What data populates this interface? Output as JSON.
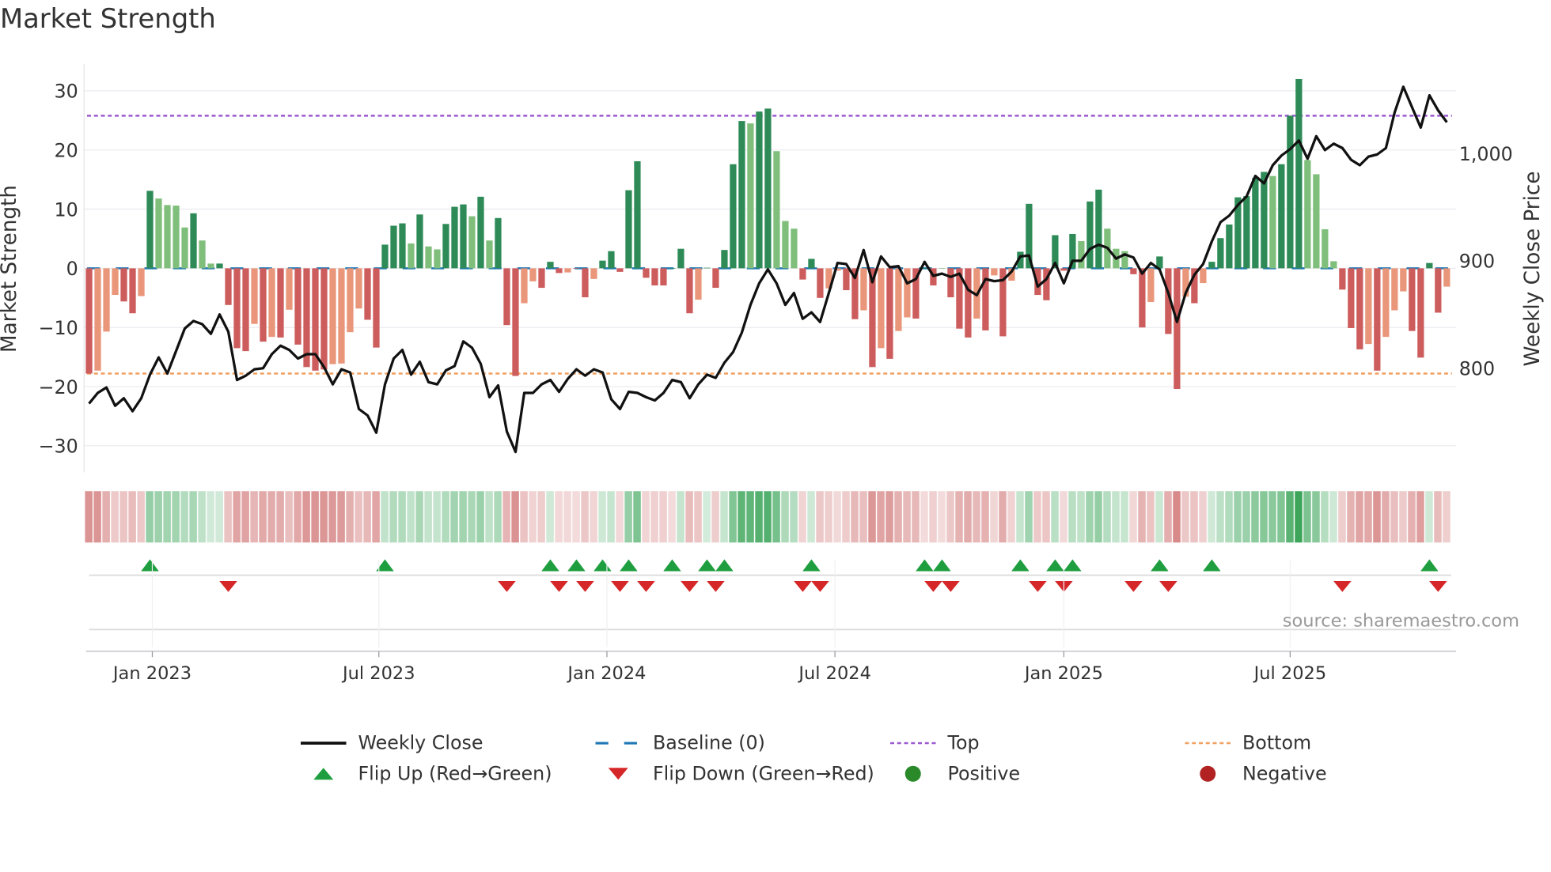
{
  "title": "Market Strength",
  "source": "source: sharemaestro.com",
  "colors": {
    "strong_up": "#2e8b57",
    "weak_up": "#7fbf7b",
    "strong_down": "#cd5c5c",
    "weak_down": "#e9967a",
    "close": "#111111",
    "baseline": "#1f77b4",
    "top": "#9b59d0",
    "bottom": "#f0a060",
    "flip_up": "#1e9e3e",
    "flip_down": "#d62728",
    "positive": "#2a8a2a",
    "negative": "#b22222"
  },
  "legend": [
    {
      "key": "close",
      "label": "Weekly Close"
    },
    {
      "key": "baseline",
      "label": "Baseline (0)"
    },
    {
      "key": "top",
      "label": "Top"
    },
    {
      "key": "bottom",
      "label": "Bottom"
    },
    {
      "key": "flip_up",
      "label": "Flip Up (Red→Green)"
    },
    {
      "key": "flip_down",
      "label": "Flip Down (Green→Red)"
    },
    {
      "key": "positive",
      "label": "Positive"
    },
    {
      "key": "negative",
      "label": "Negative"
    }
  ],
  "chart_data": {
    "type": "bar",
    "title": "Market Strength",
    "ylabel": "Market Strength",
    "y2label": "Weekly Close Price",
    "ylim": [
      -34.5,
      34.5
    ],
    "y2lim": [
      703,
      1083
    ],
    "yticks": [
      30,
      20,
      10,
      0,
      -10,
      -20,
      -30
    ],
    "ytick_labels": [
      "30",
      "20",
      "10",
      "0",
      "−10",
      "−20",
      "−30"
    ],
    "y2ticks": [
      1000,
      900,
      800
    ],
    "y2tick_labels": [
      "1,000",
      "900",
      "800"
    ],
    "xlim_weeks": [
      0.43,
      158.06
    ],
    "xticks": [
      {
        "week": 8.27,
        "label": "Jan 2023"
      },
      {
        "week": 34.3,
        "label": "Jul 2023"
      },
      {
        "week": 60.5,
        "label": "Jan 2024"
      },
      {
        "week": 86.7,
        "label": "Jul 2024"
      },
      {
        "week": 113,
        "label": "Jan 2025"
      },
      {
        "week": 139,
        "label": "Jul 2025"
      }
    ],
    "top_level": 25.8,
    "bottom_level": -17.8,
    "baseline": 0,
    "strength": [
      -17.8,
      -17.3,
      -10.7,
      -4.5,
      -5.6,
      -7.6,
      -4.7,
      13.1,
      11.8,
      10.7,
      10.6,
      6.9,
      9.3,
      4.7,
      0.8,
      0.8,
      -6.2,
      -13.5,
      -14,
      -9.4,
      -12.4,
      -11.6,
      -11.7,
      -7,
      -12.9,
      -16.7,
      -17.3,
      -17.1,
      -16.2,
      -16.1,
      -10.8,
      -6.8,
      -8.7,
      -13.4,
      4,
      7.2,
      7.6,
      4.2,
      9.1,
      3.7,
      3.2,
      7.5,
      10.4,
      10.8,
      8.8,
      12.1,
      4.7,
      8.5,
      -9.6,
      -18.2,
      -5.9,
      -2.2,
      -3.3,
      1.1,
      -0.8,
      -0.7,
      0,
      -4.9,
      -1.8,
      1.3,
      2.9,
      -0.6,
      13.2,
      18.1,
      -1.6,
      -2.9,
      -2.9,
      0,
      3.3,
      -7.6,
      -5.3,
      0.1,
      -3.3,
      3.1,
      17.6,
      24.9,
      24.5,
      26.5,
      27,
      19.8,
      8,
      6.7,
      -1.9,
      1.6,
      -5,
      -3.4,
      -0.4,
      -3.7,
      -8.6,
      -7.1,
      -16.7,
      -13.5,
      -15.3,
      -10.6,
      -8.3,
      -8.5,
      0,
      -2.9,
      0,
      -4.9,
      -10.2,
      -11.7,
      -8.5,
      -10.5,
      -1.2,
      -11.5,
      -2.1,
      2.8,
      10.9,
      -4.5,
      -5.4,
      5.6,
      -0.4,
      5.8,
      4.6,
      11.3,
      13.3,
      6.7,
      3.3,
      2.9,
      -1,
      -10,
      -5.7,
      2,
      -11.1,
      -20.4,
      -4.8,
      -5.9,
      -2.5,
      1.1,
      5.1,
      7.4,
      12,
      12.2,
      15.3,
      16.3,
      15.6,
      17.6,
      25.8,
      32,
      18.3,
      15.9,
      6.6,
      1.2,
      -3.6,
      -10.1,
      -13.7,
      -12.8,
      -17.3,
      -11.6,
      -7.1,
      -3.9,
      -10.6,
      -15.1,
      0.9,
      -7.5,
      -3.1
    ],
    "strength_class": "RrrrRRrGggggGggGRRRrRrRrRRRRrrrrRRGGGgGggGGGgGgGRRrrRGRrRRrGGRGGRRRGGRrGRGGGgGGgggRGRrrRRrRrRrrRGRgRRRrRrRrGGRRGRGgGGgggRRrGRRrRrGGGGGGGgGGGggggRRRrRrrrRRGRr",
    "close": [
      767,
      777,
      782,
      765,
      772,
      760,
      772,
      794,
      810,
      795,
      816,
      837,
      844,
      841,
      832,
      850,
      834,
      789,
      793,
      799,
      800,
      813,
      821,
      817,
      809,
      813,
      813,
      801,
      785,
      799,
      796,
      762,
      756,
      740,
      785,
      809,
      817,
      794,
      806,
      787,
      785,
      798,
      802,
      825,
      819,
      804,
      773,
      784,
      741,
      722,
      777,
      777,
      785,
      789,
      778,
      790,
      799,
      793,
      799,
      796,
      771,
      762,
      778,
      777,
      773,
      770,
      777,
      789,
      787,
      772,
      785,
      794,
      791,
      805,
      815,
      833,
      859,
      879,
      892,
      879,
      859,
      870,
      846,
      852,
      843,
      870,
      898,
      897,
      884,
      910,
      880,
      904,
      894,
      895,
      879,
      883,
      899,
      886,
      888,
      885,
      888,
      873,
      868,
      883,
      881,
      882,
      890,
      904,
      905,
      876,
      883,
      898,
      879,
      900,
      900,
      911,
      915,
      912,
      902,
      906,
      903,
      888,
      898,
      892,
      870,
      843,
      870,
      887,
      897,
      918,
      936,
      942,
      952,
      960,
      979,
      972,
      989,
      998,
      1004,
      1012,
      995,
      1016,
      1003,
      1009,
      1005,
      994,
      989,
      997,
      999,
      1005,
      1038,
      1062,
      1043,
      1024,
      1054,
      1040,
      1029
    ],
    "flip_up_weeks": [
      8,
      35,
      54,
      57,
      60,
      63,
      68,
      72,
      74,
      84,
      97,
      99,
      108,
      112,
      114,
      124,
      130,
      155
    ],
    "flip_down_weeks": [
      17,
      49,
      55,
      58,
      62,
      65,
      70,
      73,
      83,
      85,
      98,
      100,
      110,
      113,
      121,
      125,
      145,
      156
    ]
  }
}
